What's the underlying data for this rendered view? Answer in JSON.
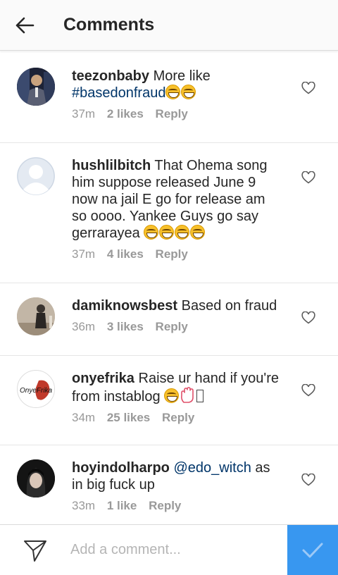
{
  "header": {
    "title": "Comments",
    "back_icon": "arrow-left-icon"
  },
  "comments": [
    {
      "username": "teezonbaby",
      "text": "More like",
      "hashtag": "#basedonfraud",
      "emoji_count": 2,
      "time": "37m",
      "likes": "2 likes",
      "reply": "Reply"
    },
    {
      "username": "hushlilbitch",
      "text": "That Ohema song him suppose released June 9 now na jail E go for release am so oooo. Yankee Guys go say gerrarayea",
      "emoji_count": 4,
      "time": "37m",
      "likes": "4 likes",
      "reply": "Reply"
    },
    {
      "username": "damiknowsbest",
      "text": "Based on fraud",
      "time": "36m",
      "likes": "3 likes",
      "reply": "Reply"
    },
    {
      "username": "onyefrika",
      "text": "Raise ur hand if you're from instablog",
      "time": "34m",
      "likes": "25 likes",
      "reply": "Reply",
      "avatar_logo": "OnyeFrika"
    },
    {
      "username": "hoyindolharpo",
      "mention": "@edo_witch",
      "text": "as in big fuck up",
      "time": "33m",
      "likes": "1 like",
      "reply": "Reply"
    }
  ],
  "footer": {
    "placeholder": "Add a comment...",
    "send_icon": "paper-plane-icon",
    "post_icon": "checkmark-icon"
  },
  "colors": {
    "accent": "#3897f0",
    "link": "#003569",
    "muted": "#999999"
  }
}
